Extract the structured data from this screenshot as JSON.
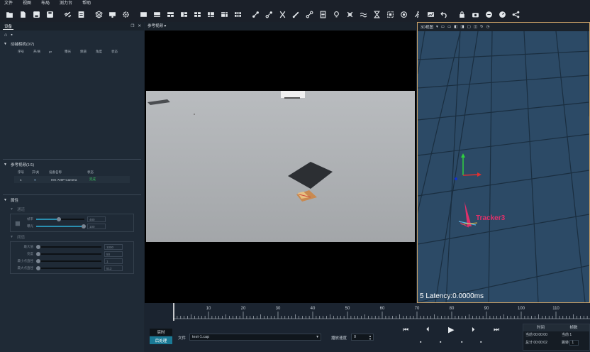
{
  "menu": [
    "文件",
    "视图",
    "布局",
    "测力台",
    "帮助"
  ],
  "toolbar_icons": [
    "folder-open-icon",
    "new-file-icon",
    "save-icon",
    "save-as-icon",
    "link-off-icon",
    "export-icon",
    "layers-icon",
    "monitor-icon",
    "gear-icon",
    "view-single-icon",
    "view-split-h-icon",
    "view-split-v-icon",
    "view-triple-icon",
    "view-quad-icon",
    "view-grid-a-icon",
    "view-grid-b-icon",
    "view-grid-c-icon",
    "marker-link-icon",
    "marker-unlink-icon",
    "cut-icon",
    "bone-icon",
    "joint-icon",
    "calculator-icon",
    "bulb-icon",
    "cross-icon",
    "wave-icon",
    "hourglass-icon",
    "crop-icon",
    "target-icon",
    "runner-icon",
    "chart-icon",
    "undo-icon",
    "lock-icon",
    "camera-icon",
    "brush-icon",
    "gauge-icon",
    "share-icon"
  ],
  "left": {
    "tab_label": "设备",
    "motion_cams": {
      "title": "动捕相机(0/7)",
      "headers": [
        "序号",
        "开/关",
        "IP",
        "曝光",
        "频道",
        "角度",
        "状态"
      ]
    },
    "ref_video": {
      "title": "参考视频(1/1)",
      "headers": [
        "序号",
        "开/关",
        "设备名称",
        "状态"
      ],
      "row": {
        "index": "1",
        "name": "HIK 720P Camera",
        "status": "完成"
      }
    },
    "props": {
      "title": "属性",
      "group1": "通道",
      "rows1": [
        {
          "label": "帧率",
          "value": "480",
          "level": 0.46
        },
        {
          "label": "曝光",
          "value": "100",
          "level": 1.0
        }
      ],
      "group2": "阈值",
      "rows2": [
        {
          "label": "最大值",
          "value": "1000",
          "level": 0.0
        },
        {
          "label": "亮度",
          "value": "50",
          "level": 0.0
        },
        {
          "label": "最小点直径",
          "value": "1",
          "level": 0.0
        },
        {
          "label": "最大点直径",
          "value": "512",
          "level": 0.0
        }
      ]
    }
  },
  "center": {
    "title": "参考视频"
  },
  "v3d": {
    "title": "3D视图",
    "tracker": "Tracker3",
    "latency": "5  Latency:0.0000ms"
  },
  "bottom": {
    "ticks": [
      "10",
      "20",
      "30",
      "40",
      "50",
      "60",
      "70",
      "80",
      "90",
      "100",
      "110",
      "120"
    ],
    "mode_realtime": "实时",
    "mode_post": "后处理",
    "file_label": "文件",
    "file_value": "test-1.cap",
    "speed_label": "播放速度",
    "speed_value": "0",
    "time_header": "时间",
    "frame_header": "帧数",
    "cur_label": "当前",
    "cur_time": "00:00:00",
    "total_label": "总计",
    "total_time": "00:00:02",
    "cur_frame_label": "当前",
    "cur_frame": "1",
    "jump_label": "跳转",
    "jump_value": "1"
  },
  "colors": {
    "accent": "#2a8fb0",
    "tracker": "#e0306a",
    "green_status": "#3cc060"
  }
}
